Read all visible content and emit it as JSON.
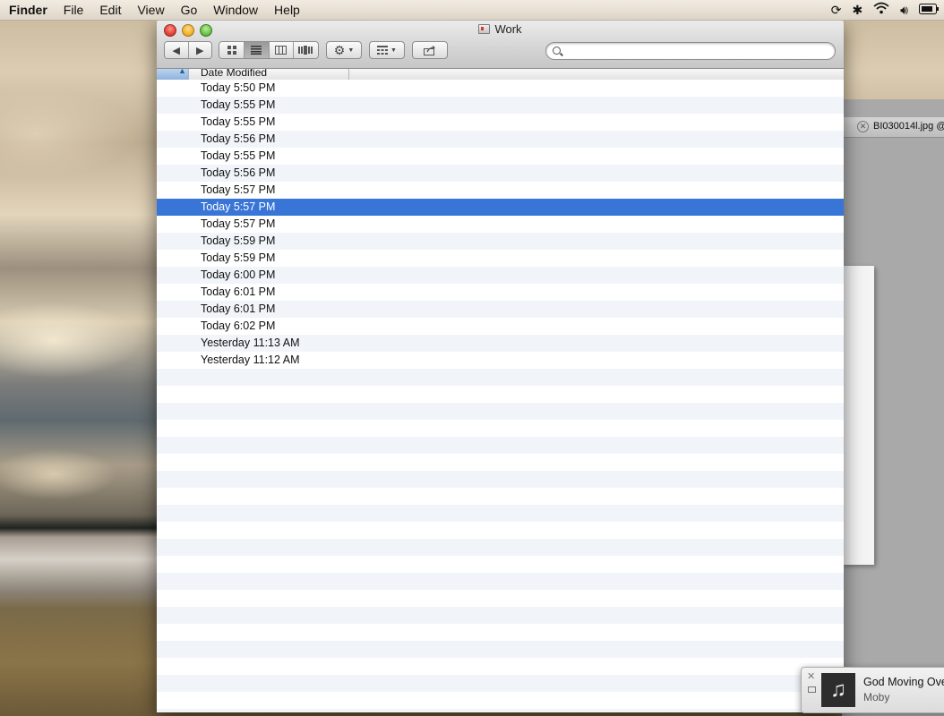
{
  "menubar": {
    "app_name": "Finder",
    "items": [
      "File",
      "Edit",
      "View",
      "Go",
      "Window",
      "Help"
    ],
    "status_icons": [
      "sync-icon",
      "bluetooth-icon",
      "wifi-icon",
      "volume-icon",
      "battery-icon"
    ]
  },
  "window": {
    "title": "Work",
    "toolbar": {
      "back_icon": "back-arrow-icon",
      "forward_icon": "forward-arrow-icon",
      "view_modes": [
        "icon-view",
        "list-view",
        "column-view",
        "coverflow-view"
      ],
      "active_view": "list-view",
      "action_icon": "gear-icon",
      "arrange_icon": "arrange-icon",
      "share_icon": "share-icon"
    },
    "search": {
      "value": "",
      "placeholder": ""
    }
  },
  "list": {
    "column_header": "Date Modified",
    "sort_direction": "ascending",
    "rows": [
      {
        "date": "Today 5:50 PM",
        "selected": false
      },
      {
        "date": "Today 5:55 PM",
        "selected": false
      },
      {
        "date": "Today 5:55 PM",
        "selected": false
      },
      {
        "date": "Today 5:56 PM",
        "selected": false
      },
      {
        "date": "Today 5:55 PM",
        "selected": false
      },
      {
        "date": "Today 5:56 PM",
        "selected": false
      },
      {
        "date": "Today 5:57 PM",
        "selected": false
      },
      {
        "date": "Today 5:57 PM",
        "selected": true
      },
      {
        "date": "Today 5:57 PM",
        "selected": false
      },
      {
        "date": "Today 5:59 PM",
        "selected": false
      },
      {
        "date": "Today 5:59 PM",
        "selected": false
      },
      {
        "date": "Today 6:00 PM",
        "selected": false
      },
      {
        "date": "Today 6:01 PM",
        "selected": false
      },
      {
        "date": "Today 6:01 PM",
        "selected": false
      },
      {
        "date": "Today 6:02 PM",
        "selected": false
      },
      {
        "date": "Yesterday 11:13 AM",
        "selected": false
      },
      {
        "date": "Yesterday 11:12 AM",
        "selected": false
      }
    ]
  },
  "background_app": {
    "tab_label": "BI030014l.jpg @"
  },
  "notification": {
    "title": "God Moving Ove",
    "subtitle": "Moby",
    "artwork_icon": "music-note-icon"
  },
  "colors": {
    "selection": "#3875d7",
    "alt_row": "#f1f5fa"
  }
}
